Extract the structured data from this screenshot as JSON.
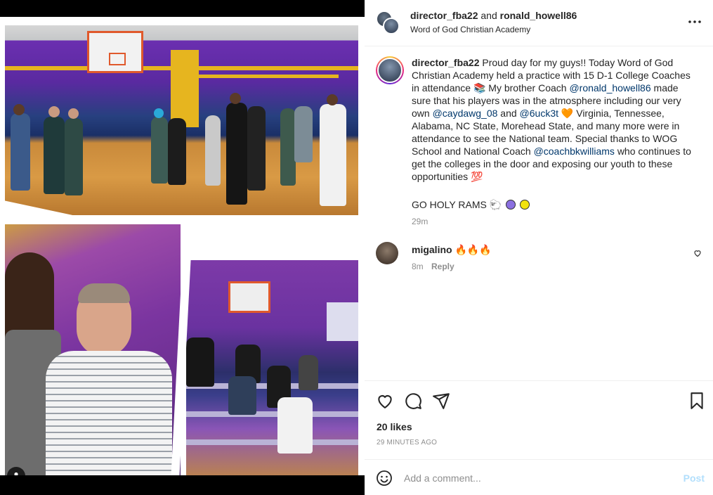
{
  "header": {
    "user1": "director_fba22",
    "and_text": "and",
    "user2": "ronald_howell86",
    "location": "Word of God Christian Academy",
    "more_icon": "more-horizontal-icon"
  },
  "caption": {
    "username": "director_fba22",
    "text_part1": "Proud day for my guys!! Today Word of God Christian Academy held a practice with 15 D-1 College Coaches in attendance 📚 My brother Coach",
    "mention1": "@ronald_howell86",
    "text_part2": "made sure that his players was in the atmosphere including our very own",
    "mention2": "@caydawg_08",
    "text_and": "and",
    "mention3": "@6uck3t",
    "text_part3": "🧡 Virginia, Tennessee, Alabama, NC State, Morehead State, and many more were in attendance to see the National team. Special thanks to WOG School and National Coach",
    "mention4": "@coachbkwilliams",
    "text_part4": "who continues to get the colleges in the door and exposing our youth to these opportunities 💯",
    "go_holy_rams": "GO HOLY RAMS 🐑",
    "time": "29m"
  },
  "comment": {
    "username": "migalino",
    "text": "🔥🔥🔥",
    "time": "8m",
    "reply_label": "Reply"
  },
  "actions": {
    "likes": "20 likes",
    "posted_ago": "29 MINUTES AGO"
  },
  "add_comment": {
    "placeholder": "Add a comment...",
    "post_label": "Post"
  },
  "colors": {
    "mention": "#00376b",
    "post_disabled": "#b2dffc",
    "dot_purple": "#8a6fe0",
    "dot_yellow": "#f2e20f"
  }
}
